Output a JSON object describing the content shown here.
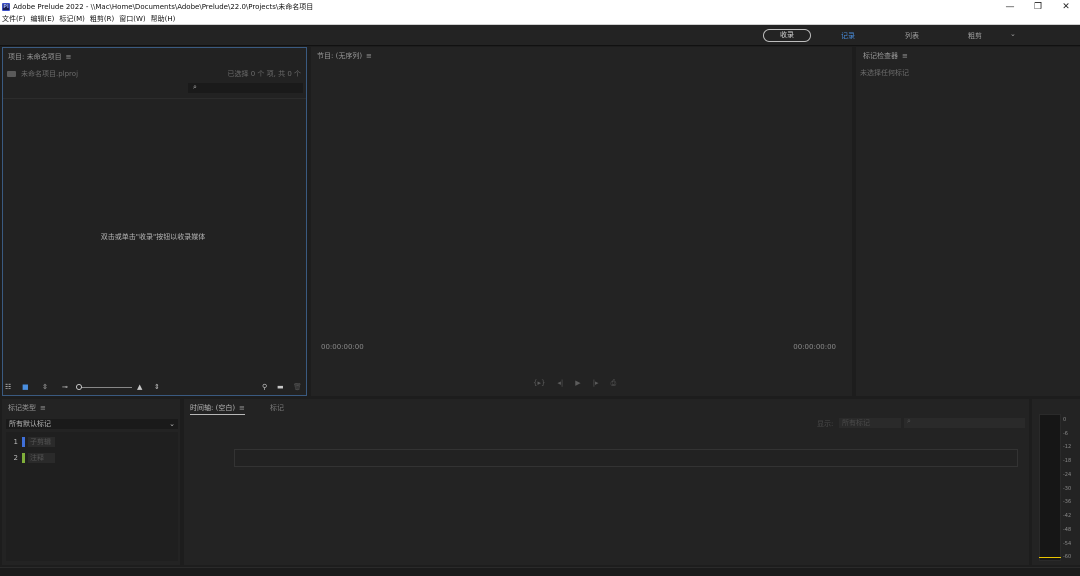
{
  "window": {
    "title": "Adobe Prelude 2022 - \\\\Mac\\Home\\Documents\\Adobe\\Prelude\\22.0\\Projects\\未命名项目",
    "app_icon": "Pl",
    "controls": [
      "—",
      "❐",
      "✕"
    ]
  },
  "menu": [
    "文件(F)",
    "编辑(E)",
    "标记(M)",
    "粗剪(R)",
    "窗口(W)",
    "帮助(H)"
  ],
  "workspaces": {
    "ingest_label": "收录",
    "tabs": [
      {
        "label": "记录",
        "active": true
      },
      {
        "label": "列表",
        "active": false
      },
      {
        "label": "粗剪",
        "active": false
      }
    ],
    "more": "⌄"
  },
  "project_panel": {
    "title": "项目: 未命名项目",
    "menu_glyph": "≡",
    "file_name": "未命名项目.plproj",
    "selection_count": "已选择 0 个 项, 共 0 个",
    "search_placeholder": "",
    "empty_message": "双击或单击\"收录\"按钮以收录媒体"
  },
  "program_panel": {
    "title": "节目: (无序列)",
    "menu_glyph": "≡",
    "timecode_in": "00:00:00:00",
    "timecode_out": "00:00:00:00"
  },
  "marker_inspector": {
    "title": "标记检查器",
    "menu_glyph": "≡",
    "empty_message": "未选择任何标记"
  },
  "marker_types": {
    "title": "标记类型",
    "menu_glyph": "≡",
    "filter_value": "所有默认标记",
    "items": [
      {
        "num": "1",
        "label": "子剪辑",
        "color": "#3f6fd8"
      },
      {
        "num": "2",
        "label": "注释",
        "color": "#7fae3a"
      }
    ]
  },
  "timeline_panel": {
    "tabs": [
      {
        "label": "时间轴: (空白)",
        "active": true
      },
      {
        "label": "标记",
        "active": false
      }
    ],
    "menu_glyph": "≡",
    "show_label": "显示:",
    "show_filter": "所有标记"
  },
  "audio_meter": {
    "ticks": [
      "0",
      "-6",
      "-12",
      "-18",
      "-24",
      "-30",
      "-36",
      "-42",
      "-48",
      "-54",
      "-60"
    ],
    "peak_color": "#e8c400"
  }
}
